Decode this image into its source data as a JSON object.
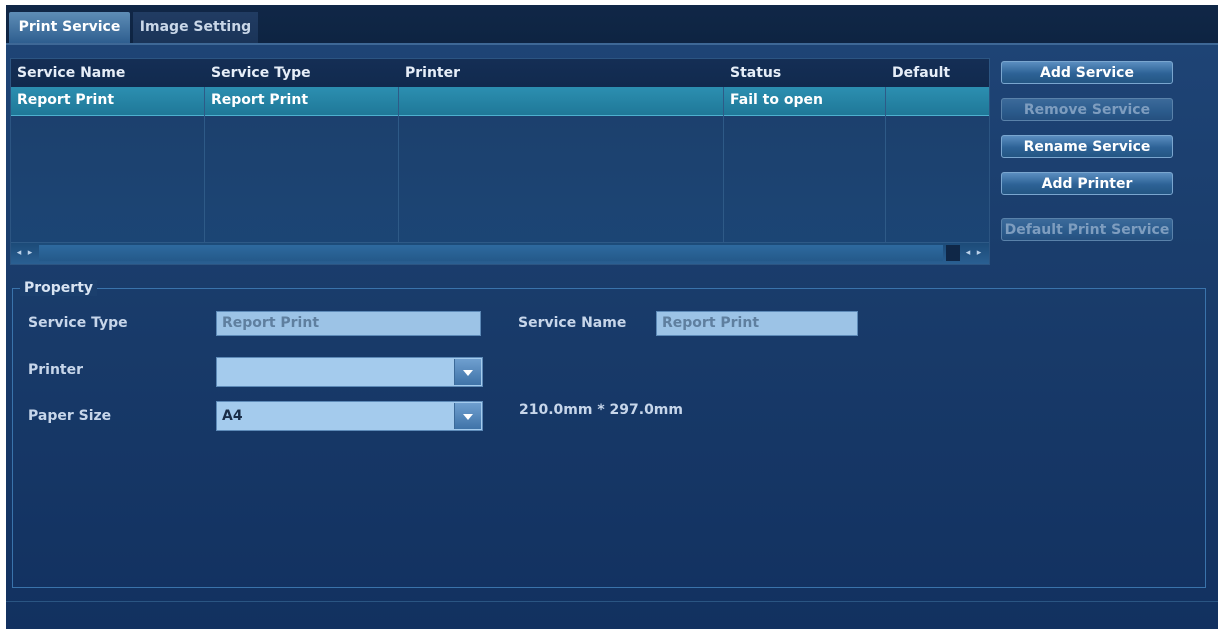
{
  "tabs": [
    {
      "label": "Print Service"
    },
    {
      "label": "Image Setting"
    }
  ],
  "table": {
    "columns": [
      "Service Name",
      "Service Type",
      "Printer",
      "Status",
      "Default"
    ],
    "rows": [
      {
        "service_name": "Report Print",
        "service_type": "Report Print",
        "printer": "",
        "status": "Fail to open",
        "default": ""
      }
    ]
  },
  "actions": {
    "add_service": "Add Service",
    "remove_service": "Remove Service",
    "rename_service": "Rename Service",
    "add_printer": "Add Printer",
    "default_print_service": "Default Print Service"
  },
  "property": {
    "legend": "Property",
    "service_type_label": "Service Type",
    "service_type_value": "Report Print",
    "service_name_label": "Service Name",
    "service_name_value": "Report Print",
    "printer_label": "Printer",
    "printer_value": "",
    "paper_size_label": "Paper Size",
    "paper_size_value": "A4",
    "paper_dimensions": "210.0mm * 297.0mm"
  },
  "scroll_icons": {
    "left": "◂",
    "right": "▸"
  },
  "colors": {
    "selected_row": "#2c8fb1",
    "background": "#1a3d6c",
    "input": "#9cc3e6"
  }
}
